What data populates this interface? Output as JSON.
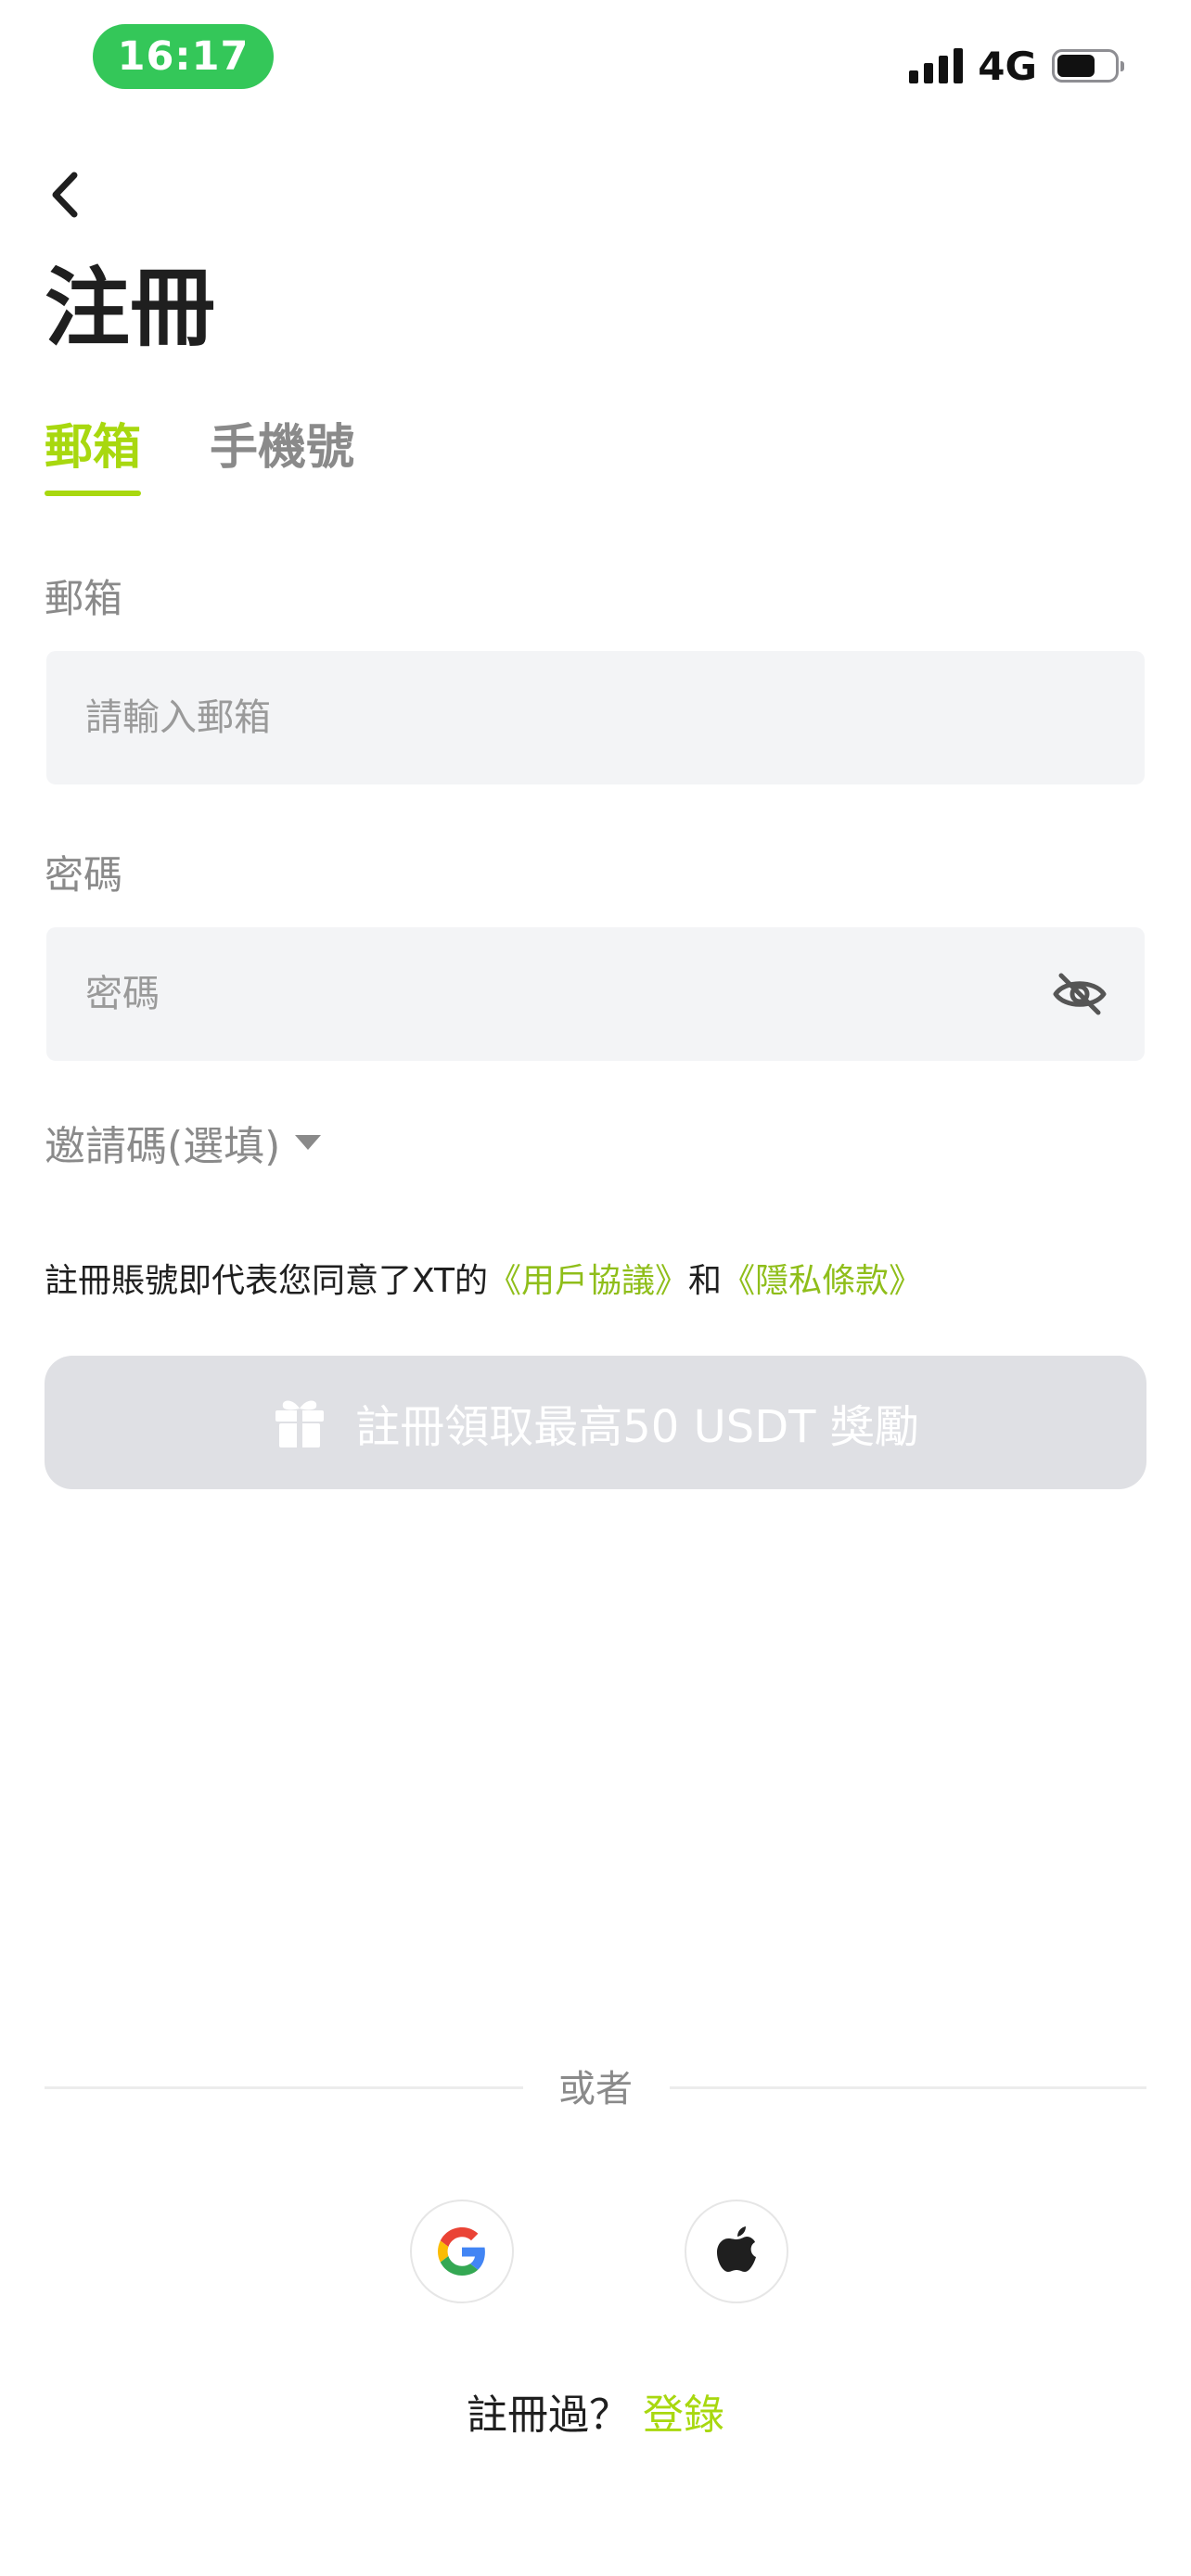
{
  "status_bar": {
    "time": "16:17",
    "network": "4G",
    "battery_level": 0.66
  },
  "header": {
    "back_icon": "chevron-left-icon",
    "title": "注冊"
  },
  "tabs": [
    {
      "label": "郵箱",
      "active": true
    },
    {
      "label": "手機號",
      "active": false
    }
  ],
  "form": {
    "email": {
      "label": "郵箱",
      "placeholder": "請輸入郵箱",
      "value": ""
    },
    "password": {
      "label": "密碼",
      "placeholder": "密碼",
      "value": "",
      "toggle_icon": "eye-off-icon"
    },
    "invite_code": {
      "label": "邀請碼(選填)",
      "icon": "caret-down-icon"
    }
  },
  "agreement": {
    "prefix": "註冊賬號即代表您同意了XT的",
    "user_agreement": "《用戶協議》",
    "conjunction": "和",
    "privacy_policy": "《隱私條款》"
  },
  "register_button": {
    "label": "註冊領取最高50 USDT 獎勵",
    "icon": "gift-icon",
    "enabled": false
  },
  "divider": {
    "label": "或者"
  },
  "social": [
    {
      "name": "google",
      "icon": "google-icon"
    },
    {
      "name": "apple",
      "icon": "apple-icon"
    }
  ],
  "login_prompt": {
    "text": "註冊過？",
    "link": "登錄"
  },
  "colors": {
    "accent": "#a8d80f",
    "link": "#8fbe1a",
    "time_pill": "#34c759",
    "input_bg": "#f3f4f6",
    "button_disabled": "#dfe0e4"
  }
}
